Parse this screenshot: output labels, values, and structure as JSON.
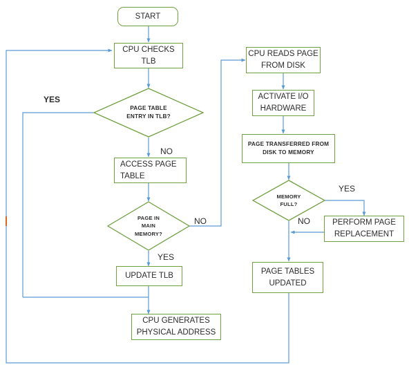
{
  "diagram": {
    "title": "Virtual memory address translation flowchart",
    "colors": {
      "node_border": "#6f9f3f",
      "edge": "#5b9bd5",
      "text": "#2b2b2b",
      "background": "#ffffff",
      "marker": "#d2691e"
    },
    "nodes": {
      "start": "START",
      "cpu_checks_tlb": "CPU CHECKS\nTLB",
      "page_table_entry_in_tlb": "PAGE TABLE\nENTRY IN TLB?",
      "access_page_table": "ACCESS PAGE\nTABLE",
      "page_in_main_memory": "PAGE IN\nMAIN\nMEMORY?",
      "update_tlb": "UPDATE TLB",
      "cpu_generates_physical_address": "CPU GENERATES\nPHYSICAL ADDRESS",
      "cpu_reads_page_from_disk": "CPU READS PAGE\nFROM DISK",
      "activate_io_hardware": "ACTIVATE I/O\nHARDWARE",
      "page_transferred_from_disk_to_memory": "PAGE TRANSFERRED FROM\nDISK TO MEMORY",
      "memory_full": "MEMORY\nFULL?",
      "perform_page_replacement": "PERFORM PAGE\nREPLACEMENT",
      "page_tables_updated": "PAGE TABLES\nUPDATED"
    },
    "edge_labels": {
      "tlb_yes": "YES",
      "tlb_no": "NO",
      "memory_no": "NO",
      "memory_yes": "YES",
      "mem_full_yes": "YES",
      "mem_full_no": "NO"
    }
  }
}
